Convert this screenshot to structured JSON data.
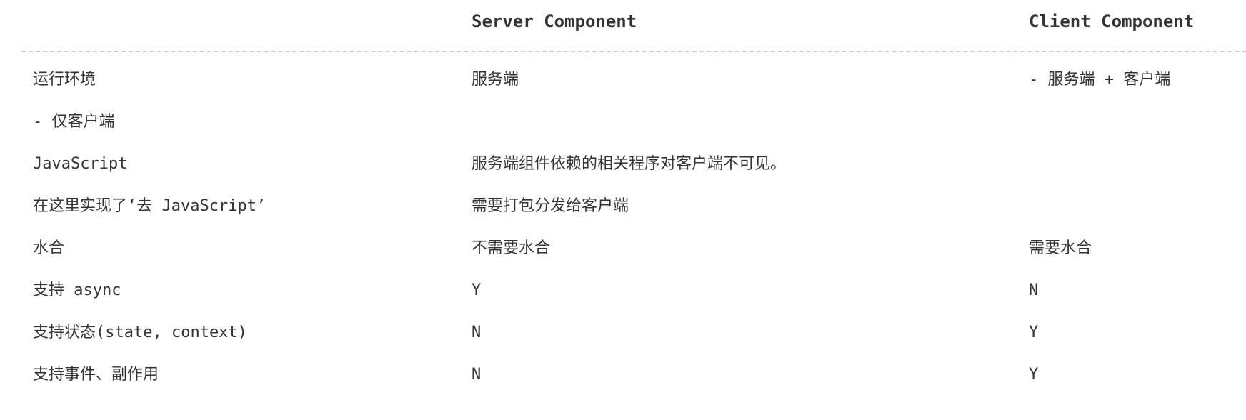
{
  "header": {
    "col1": "",
    "col2": "Server Component",
    "col3": "Client Component"
  },
  "rows": [
    {
      "col1": "运行环境",
      "col2": "服务端",
      "col3": "- 服务端 + 客户端"
    },
    {
      "col1": "- 仅客户端",
      "col2": "",
      "col3": ""
    },
    {
      "col1": "JavaScript",
      "col2": "服务端组件依赖的相关程序对客户端不可见。",
      "col3": ""
    },
    {
      "col1": "在这里实现了‘去 JavaScript’",
      "col2": "需要打包分发给客户端",
      "col3": ""
    },
    {
      "col1": "水合",
      "col2": "不需要水合",
      "col3": "需要水合"
    },
    {
      "col1": "支持 async",
      "col2": "Y",
      "col3": "N"
    },
    {
      "col1": "支持状态(state, context)",
      "col2": "N",
      "col3": "Y"
    },
    {
      "col1": "支持事件、副作用",
      "col2": "N",
      "col3": "Y"
    }
  ]
}
